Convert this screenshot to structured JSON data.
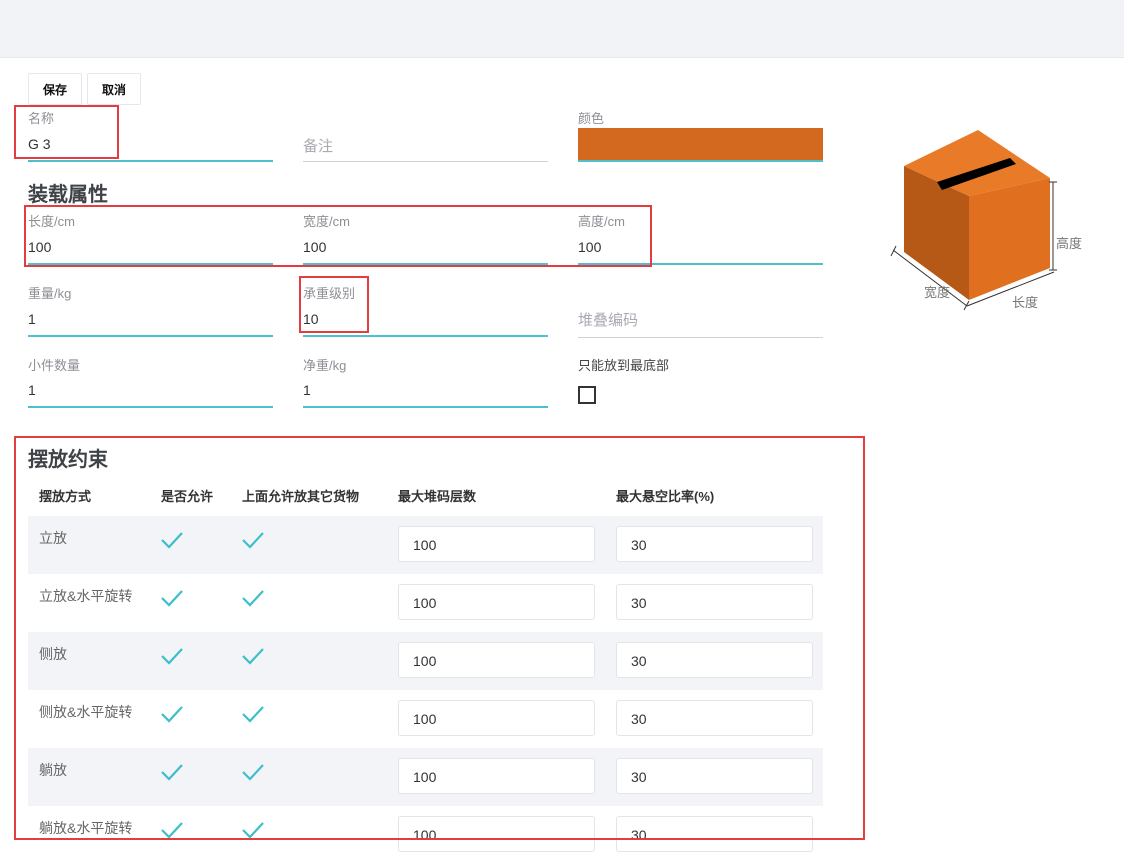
{
  "toolbar": {
    "save_label": "保存",
    "cancel_label": "取消"
  },
  "basic": {
    "name_label": "名称",
    "name_value": "G 3",
    "remark_placeholder": "备注",
    "color_label": "颜色",
    "color_value": "#d2691e"
  },
  "loading": {
    "title": "装载属性",
    "length_label": "长度/cm",
    "length_value": "100",
    "width_label": "宽度/cm",
    "width_value": "100",
    "height_label": "高度/cm",
    "height_value": "100",
    "weight_label": "重量/kg",
    "weight_value": "1",
    "bearing_label": "承重级别",
    "bearing_value": "10",
    "stack_code_placeholder": "堆叠编码",
    "pieces_label": "小件数量",
    "pieces_value": "1",
    "net_weight_label": "净重/kg",
    "net_weight_value": "1",
    "bottom_only_label": "只能放到最底部",
    "bottom_only_checked": false
  },
  "box_preview": {
    "height_label": "高度",
    "width_label": "宽度",
    "length_label": "长度",
    "box_color": "#e07020"
  },
  "placement": {
    "title": "摆放约束",
    "headers": [
      "摆放方式",
      "是否允许",
      "上面允许放其它货物",
      "最大堆码层数",
      "最大悬空比率(%)"
    ],
    "rows": [
      {
        "mode": "立放",
        "allowed": true,
        "stack_on_top": true,
        "max_layers": "100",
        "overhang": "30"
      },
      {
        "mode": "立放&水平旋转",
        "allowed": true,
        "stack_on_top": true,
        "max_layers": "100",
        "overhang": "30"
      },
      {
        "mode": "侧放",
        "allowed": true,
        "stack_on_top": true,
        "max_layers": "100",
        "overhang": "30"
      },
      {
        "mode": "侧放&水平旋转",
        "allowed": true,
        "stack_on_top": true,
        "max_layers": "100",
        "overhang": "30"
      },
      {
        "mode": "躺放",
        "allowed": true,
        "stack_on_top": true,
        "max_layers": "100",
        "overhang": "30"
      },
      {
        "mode": "躺放&水平旋转",
        "allowed": true,
        "stack_on_top": true,
        "max_layers": "100",
        "overhang": "30"
      }
    ]
  },
  "colors": {
    "accent": "#4cc0cf",
    "highlight": "#e43d40",
    "row_shade": "#f3f4f8"
  }
}
